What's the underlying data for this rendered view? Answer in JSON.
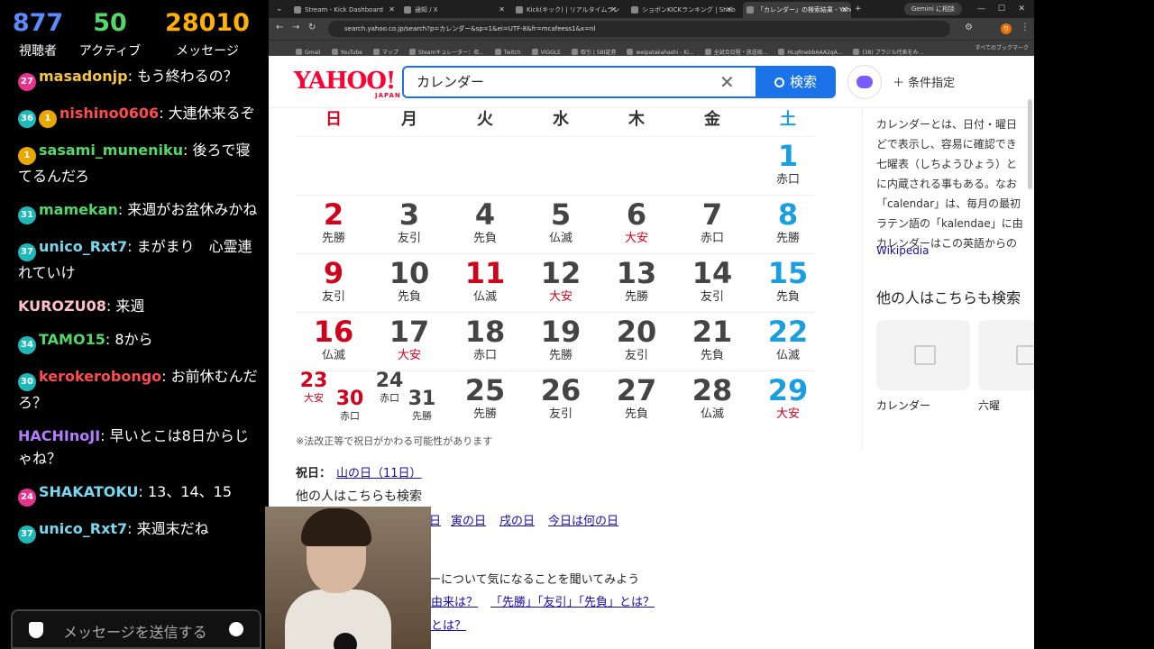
{
  "stats": [
    {
      "value": "877",
      "label": "視聴者",
      "color": "#5b8cff"
    },
    {
      "value": "50",
      "label": "アクティブ",
      "color": "#53d769"
    },
    {
      "value": "28010",
      "label": "メッセージ",
      "color": "#ffb000"
    }
  ],
  "chat": [
    {
      "badges": [
        "27"
      ],
      "user": "masadonjp",
      "color": "#f5c542",
      "text": "もう終わるの？"
    },
    {
      "badges": [
        "36",
        "1"
      ],
      "user": "nishino0606",
      "color": "#ff4d4d",
      "text": "大連休来るぞ"
    },
    {
      "badges": [
        "1"
      ],
      "user": "sasami_muneniku",
      "color": "#53d769",
      "text": "後ろで寝てるんだろ"
    },
    {
      "badges": [
        "31"
      ],
      "user": "mamekan",
      "color": "#53d769",
      "text": "来週がお盆休みかね"
    },
    {
      "badges": [
        "37"
      ],
      "user": "unico_Rxt7",
      "color": "#7ad7f0",
      "text": "まがまり　心霊連れていけ"
    },
    {
      "badges": [],
      "user": "KUROZU08",
      "color": "#ffc0cb",
      "text": "来週"
    },
    {
      "badges": [
        "34"
      ],
      "user": "TAMO15",
      "color": "#53d769",
      "text": "8から"
    },
    {
      "badges": [
        "30"
      ],
      "user": "kerokerobongo",
      "color": "#ff4d4d",
      "text": "お前休むんだろ？"
    },
    {
      "badges": [],
      "user": "HACHInoJI",
      "color": "#b47cff",
      "text": "早いとこは8日からじゃね？"
    },
    {
      "badges": [
        "24"
      ],
      "user": "SHAKATOKU",
      "color": "#7ad7f0",
      "text": "13、14、15"
    },
    {
      "badges": [
        "37"
      ],
      "user": "unico_Rxt7",
      "color": "#7ad7f0",
      "text": "来週末だね"
    }
  ],
  "chat_input": {
    "placeholder": "メッセージを送信する"
  },
  "browser": {
    "tabs": [
      "Stream - Kick Dashboard",
      "通知 / X",
      "Kick(キック) | リアルタイムランキング",
      "ショボンKICKランキング | Shobon",
      "「カレンダー」の検索結果 - Yahoo!"
    ],
    "gemini": "Gemini に相談",
    "url": "search.yahoo.co.jp/search?p=カレンダー&sp=1&ei=UTF-8&fr=mcafeess1&x=nl",
    "bookmarks": [
      "Gmail",
      "YouTube",
      "マップ",
      "Steamキュレーター：収...",
      "Twitch",
      "VIGGLE",
      "取引 | SBI証券",
      "weipatakahashi - Ki...",
      "全試合日程・放送局...",
      "HLqRnebbAAA2qA...",
      "(38) ブラジル代表をみ..."
    ],
    "all_bookmarks": "すべてのブックマーク"
  },
  "yahoo": {
    "logo": "YAHOO!",
    "logo_sub": "JAPAN",
    "query": "カレンダー",
    "search_button": "検索",
    "conditions": "条件指定"
  },
  "calendar": {
    "weekdays": [
      "日",
      "月",
      "火",
      "水",
      "木",
      "金",
      "土"
    ],
    "colors": {
      "sun": "#d0021b",
      "sat": "#1a9ee0",
      "holiday": "#d0021b",
      "weekday": "#444444"
    },
    "weeks": [
      [
        null,
        null,
        null,
        null,
        null,
        null,
        {
          "day": "1",
          "rokuyo": "赤口"
        }
      ],
      [
        {
          "day": "2",
          "rokuyo": "先勝"
        },
        {
          "day": "3",
          "rokuyo": "友引"
        },
        {
          "day": "4",
          "rokuyo": "先負"
        },
        {
          "day": "5",
          "rokuyo": "仏滅"
        },
        {
          "day": "6",
          "rokuyo": "大安"
        },
        {
          "day": "7",
          "rokuyo": "赤口"
        },
        {
          "day": "8",
          "rokuyo": "先勝"
        }
      ],
      [
        {
          "day": "9",
          "rokuyo": "友引"
        },
        {
          "day": "10",
          "rokuyo": "先負"
        },
        {
          "day": "11",
          "rokuyo": "仏滅",
          "holiday": true
        },
        {
          "day": "12",
          "rokuyo": "大安"
        },
        {
          "day": "13",
          "rokuyo": "先勝"
        },
        {
          "day": "14",
          "rokuyo": "友引"
        },
        {
          "day": "15",
          "rokuyo": "先負"
        }
      ],
      [
        {
          "day": "16",
          "rokuyo": "仏滅"
        },
        {
          "day": "17",
          "rokuyo": "大安"
        },
        {
          "day": "18",
          "rokuyo": "赤口"
        },
        {
          "day": "19",
          "rokuyo": "先勝"
        },
        {
          "day": "20",
          "rokuyo": "友引"
        },
        {
          "day": "21",
          "rokuyo": "先負"
        },
        {
          "day": "22",
          "rokuyo": "仏滅"
        }
      ],
      [
        null,
        null,
        {
          "day": "25",
          "rokuyo": "先勝"
        },
        {
          "day": "26",
          "rokuyo": "友引"
        },
        {
          "day": "27",
          "rokuyo": "先負"
        },
        {
          "day": "28",
          "rokuyo": "仏滅"
        },
        {
          "day": "29",
          "rokuyo": "大安"
        }
      ]
    ],
    "split_cells": [
      {
        "day": "23",
        "rokuyo": "大安"
      },
      {
        "day": "30",
        "rokuyo": "赤口"
      },
      {
        "day": "24",
        "rokuyo": "赤口"
      },
      {
        "day": "31",
        "rokuyo": "先勝"
      }
    ],
    "note": "※法改正等で祝日がかわる可能性があります",
    "holiday_label": "祝日：",
    "holiday_link": "山の日（11日）"
  },
  "related": {
    "title": "他の人はこちらも検索",
    "links": [
      "日",
      "寅の日",
      "戌の日",
      "今日は何の日"
    ],
    "ask": "ーについて気になることを聞いてみよう",
    "faq": [
      "由来は？",
      "「先勝」「友引」「先負」とは？",
      "とは？"
    ]
  },
  "panel": {
    "desc": [
      "カレンダーとは、日付・曜日",
      "どで表示し、容易に確認でき",
      "七曜表（しちようひょう）と",
      "に内蔵される事もある。なお",
      "「calendar」は、毎月の最初",
      "ラテン語の「kalendae」に由",
      "カレンダーはこの英語からの"
    ],
    "wiki": "Wikipedia",
    "others": "他の人はこちらも検索",
    "items": [
      "カレンダー",
      "六曜"
    ]
  }
}
